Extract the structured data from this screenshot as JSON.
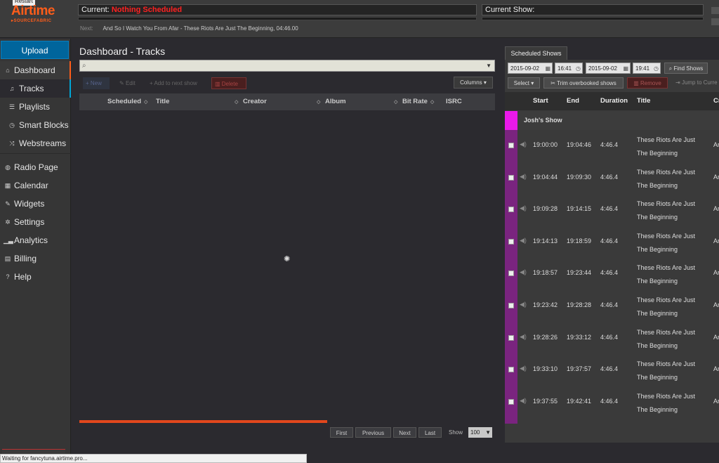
{
  "topbar": {
    "restart_label": "Restart",
    "brand": "Airtime",
    "brand_sub": "▸SOURCEFABRIC",
    "current_label": "Current:",
    "current_value": "Nothing Scheduled",
    "current_show_label": "Current Show:",
    "next_label": "Next:",
    "next_value": "And So I Watch You From Afar - These Riots Are Just The Beginning, 04:46.00"
  },
  "sidebar": {
    "upload_label": "Upload",
    "items": [
      {
        "label": "Dashboard",
        "icon": "home-icon"
      },
      {
        "label": "Tracks",
        "icon": "music-icon"
      },
      {
        "label": "Playlists",
        "icon": "list-icon"
      },
      {
        "label": "Smart Blocks",
        "icon": "clock-icon"
      },
      {
        "label": "Webstreams",
        "icon": "shuffle-icon"
      },
      {
        "label": "Radio Page",
        "icon": "globe-icon"
      },
      {
        "label": "Calendar",
        "icon": "calendar-icon"
      },
      {
        "label": "Widgets",
        "icon": "wrench-icon"
      },
      {
        "label": "Settings",
        "icon": "gear-icon"
      },
      {
        "label": "Analytics",
        "icon": "signal-icon"
      },
      {
        "label": "Billing",
        "icon": "cart-icon"
      },
      {
        "label": "Help",
        "icon": "question-icon"
      }
    ]
  },
  "main": {
    "title": "Dashboard - Tracks",
    "toolbar": {
      "new_label": "New",
      "edit_label": "Edit",
      "add_next_label": "Add to next show",
      "delete_label": "Delete",
      "columns_label": "Columns"
    },
    "columns": [
      "Scheduled",
      "Title",
      "Creator",
      "Album",
      "Bit Rate",
      "ISRC"
    ],
    "loading": true,
    "pagination": {
      "first": "First",
      "previous": "Previous",
      "next": "Next",
      "last": "Last",
      "show_label": "Show",
      "page_size": "100"
    }
  },
  "scheduled": {
    "tab_label": "Scheduled Shows",
    "start_date": "2015-09-02",
    "start_time": "16:41",
    "end_date": "2015-09-02",
    "end_time": "19:41",
    "find_label": "Find Shows",
    "select_label": "Select",
    "trim_label": "Trim overbooked shows",
    "remove_label": "Remove",
    "jump_label": "Jump to Curre",
    "columns": [
      "Start",
      "End",
      "Duration",
      "Title",
      "Cr"
    ],
    "show_name": "Josh's Show",
    "show_color": "#ea19ea",
    "rows": [
      {
        "start": "19:00:00",
        "end": "19:04:46",
        "duration": "4:46.4",
        "title": "These Riots Are Just The Beginning",
        "creator": "Ar"
      },
      {
        "start": "19:04:44",
        "end": "19:09:30",
        "duration": "4:46.4",
        "title": "These Riots Are Just The Beginning",
        "creator": "Ar"
      },
      {
        "start": "19:09:28",
        "end": "19:14:15",
        "duration": "4:46.4",
        "title": "These Riots Are Just The Beginning",
        "creator": "Ar"
      },
      {
        "start": "19:14:13",
        "end": "19:18:59",
        "duration": "4:46.4",
        "title": "These Riots Are Just The Beginning",
        "creator": "Ar"
      },
      {
        "start": "19:18:57",
        "end": "19:23:44",
        "duration": "4:46.4",
        "title": "These Riots Are Just The Beginning",
        "creator": "Ar"
      },
      {
        "start": "19:23:42",
        "end": "19:28:28",
        "duration": "4:46.4",
        "title": "These Riots Are Just The Beginning",
        "creator": "Ar"
      },
      {
        "start": "19:28:26",
        "end": "19:33:12",
        "duration": "4:46.4",
        "title": "These Riots Are Just The Beginning",
        "creator": "Ar"
      },
      {
        "start": "19:33:10",
        "end": "19:37:57",
        "duration": "4:46.4",
        "title": "These Riots Are Just The Beginning",
        "creator": "Ar"
      },
      {
        "start": "19:37:55",
        "end": "19:42:41",
        "duration": "4:46.4",
        "title": "These Riots Are Just The Beginning",
        "creator": "Ar"
      }
    ]
  },
  "statusbar": {
    "text": "Waiting for fancytuna.airtime.pro..."
  },
  "colors": {
    "brand": "#ff5d1a",
    "upload": "#00659c",
    "current_alert": "#ff2121",
    "show_block": "#7a247f"
  }
}
